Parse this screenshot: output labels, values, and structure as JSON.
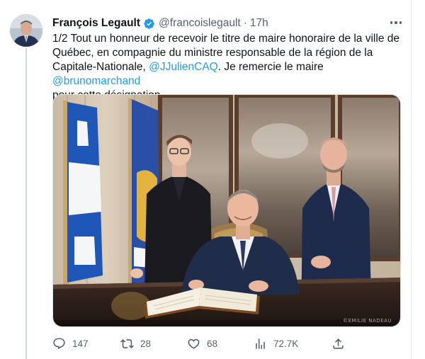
{
  "tweet": {
    "author_name": "François Legault",
    "verified": true,
    "handle": "@francoislegault",
    "separator": "·",
    "time": "17h",
    "text_lines": {
      "line1": "1/2 Tout un honneur de recevoir le titre de maire honoraire de la ville de",
      "line2": "Québec, en compagnie du ministre responsable de la région de la",
      "line3_a": "Capitale-Nationale, ",
      "line3_mention": "@JJulienCAQ",
      "line3_b": ". Je remercie le maire ",
      "line3_mention2": "@brunomarchand",
      "line4": "pour cette désignation."
    },
    "photo_credit": "©EMILIE NADEAU"
  },
  "actions": {
    "reply_count": "147",
    "retweet_count": "28",
    "like_count": "68",
    "views_count": "72.7K"
  },
  "icons": {
    "verified": "verified-badge-icon",
    "more": "more-icon",
    "reply": "reply-icon",
    "retweet": "retweet-icon",
    "like": "heart-icon",
    "views": "views-icon",
    "share": "share-icon"
  },
  "colors": {
    "accent": "#1d9bf0",
    "text": "#0f1419",
    "secondary": "#536471"
  }
}
